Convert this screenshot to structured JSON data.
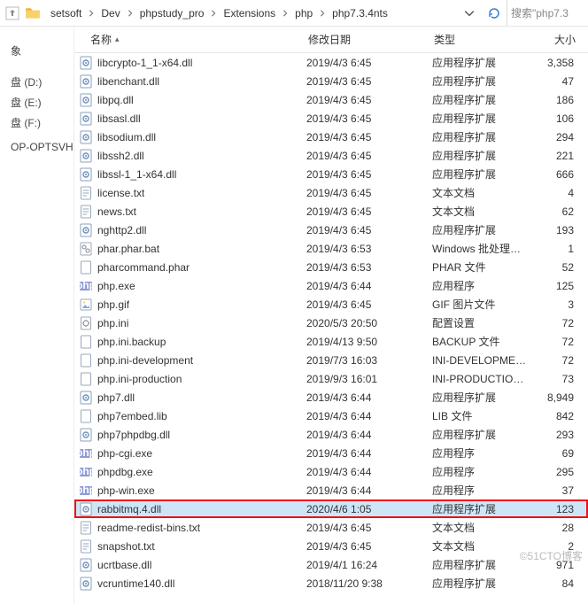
{
  "breadcrumb": [
    "setsoft",
    "Dev",
    "phpstudy_pro",
    "Extensions",
    "php",
    "php7.3.4nts"
  ],
  "search_label": "搜索\"php7.3",
  "columns": {
    "name": "名称",
    "date": "修改日期",
    "type": "类型",
    "size": "大小"
  },
  "sidebar": {
    "items": [
      "",
      "",
      "象",
      "",
      "",
      "盘 (D:)",
      "盘 (E:)",
      "盘 (F:)",
      "",
      "OP-OPTSVHD"
    ]
  },
  "watermark": "©51CTO博客",
  "rows": [
    {
      "name": "libcrypto-1_1-x64.dll",
      "date": "2019/4/3 6:45",
      "type": "应用程序扩展",
      "size": "3,358",
      "icon": "dll"
    },
    {
      "name": "libenchant.dll",
      "date": "2019/4/3 6:45",
      "type": "应用程序扩展",
      "size": "47",
      "icon": "dll"
    },
    {
      "name": "libpq.dll",
      "date": "2019/4/3 6:45",
      "type": "应用程序扩展",
      "size": "186",
      "icon": "dll"
    },
    {
      "name": "libsasl.dll",
      "date": "2019/4/3 6:45",
      "type": "应用程序扩展",
      "size": "106",
      "icon": "dll"
    },
    {
      "name": "libsodium.dll",
      "date": "2019/4/3 6:45",
      "type": "应用程序扩展",
      "size": "294",
      "icon": "dll"
    },
    {
      "name": "libssh2.dll",
      "date": "2019/4/3 6:45",
      "type": "应用程序扩展",
      "size": "221",
      "icon": "dll"
    },
    {
      "name": "libssl-1_1-x64.dll",
      "date": "2019/4/3 6:45",
      "type": "应用程序扩展",
      "size": "666",
      "icon": "dll"
    },
    {
      "name": "license.txt",
      "date": "2019/4/3 6:45",
      "type": "文本文档",
      "size": "4",
      "icon": "txt"
    },
    {
      "name": "news.txt",
      "date": "2019/4/3 6:45",
      "type": "文本文档",
      "size": "62",
      "icon": "txt"
    },
    {
      "name": "nghttp2.dll",
      "date": "2019/4/3 6:45",
      "type": "应用程序扩展",
      "size": "193",
      "icon": "dll"
    },
    {
      "name": "phar.phar.bat",
      "date": "2019/4/3 6:53",
      "type": "Windows 批处理…",
      "size": "1",
      "icon": "bat"
    },
    {
      "name": "pharcommand.phar",
      "date": "2019/4/3 6:53",
      "type": "PHAR 文件",
      "size": "52",
      "icon": "file"
    },
    {
      "name": "php.exe",
      "date": "2019/4/3 6:44",
      "type": "应用程序",
      "size": "125",
      "icon": "php"
    },
    {
      "name": "php.gif",
      "date": "2019/4/3 6:45",
      "type": "GIF 图片文件",
      "size": "3",
      "icon": "img"
    },
    {
      "name": "php.ini",
      "date": "2020/5/3 20:50",
      "type": "配置设置",
      "size": "72",
      "icon": "ini"
    },
    {
      "name": "php.ini.backup",
      "date": "2019/4/13 9:50",
      "type": "BACKUP 文件",
      "size": "72",
      "icon": "file"
    },
    {
      "name": "php.ini-development",
      "date": "2019/7/3 16:03",
      "type": "INI-DEVELOPME…",
      "size": "72",
      "icon": "file"
    },
    {
      "name": "php.ini-production",
      "date": "2019/9/3 16:01",
      "type": "INI-PRODUCTIO…",
      "size": "73",
      "icon": "file"
    },
    {
      "name": "php7.dll",
      "date": "2019/4/3 6:44",
      "type": "应用程序扩展",
      "size": "8,949",
      "icon": "dll"
    },
    {
      "name": "php7embed.lib",
      "date": "2019/4/3 6:44",
      "type": "LIB 文件",
      "size": "842",
      "icon": "file"
    },
    {
      "name": "php7phpdbg.dll",
      "date": "2019/4/3 6:44",
      "type": "应用程序扩展",
      "size": "293",
      "icon": "dll"
    },
    {
      "name": "php-cgi.exe",
      "date": "2019/4/3 6:44",
      "type": "应用程序",
      "size": "69",
      "icon": "php"
    },
    {
      "name": "phpdbg.exe",
      "date": "2019/4/3 6:44",
      "type": "应用程序",
      "size": "295",
      "icon": "php"
    },
    {
      "name": "php-win.exe",
      "date": "2019/4/3 6:44",
      "type": "应用程序",
      "size": "37",
      "icon": "php"
    },
    {
      "name": "rabbitmq.4.dll",
      "date": "2020/4/6 1:05",
      "type": "应用程序扩展",
      "size": "123",
      "icon": "dll",
      "selected": true,
      "highlight": true
    },
    {
      "name": "readme-redist-bins.txt",
      "date": "2019/4/3 6:45",
      "type": "文本文档",
      "size": "28",
      "icon": "txt"
    },
    {
      "name": "snapshot.txt",
      "date": "2019/4/3 6:45",
      "type": "文本文档",
      "size": "2",
      "icon": "txt"
    },
    {
      "name": "ucrtbase.dll",
      "date": "2019/4/1 16:24",
      "type": "应用程序扩展",
      "size": "971",
      "icon": "dll"
    },
    {
      "name": "vcruntime140.dll",
      "date": "2018/11/20 9:38",
      "type": "应用程序扩展",
      "size": "84",
      "icon": "dll"
    }
  ]
}
